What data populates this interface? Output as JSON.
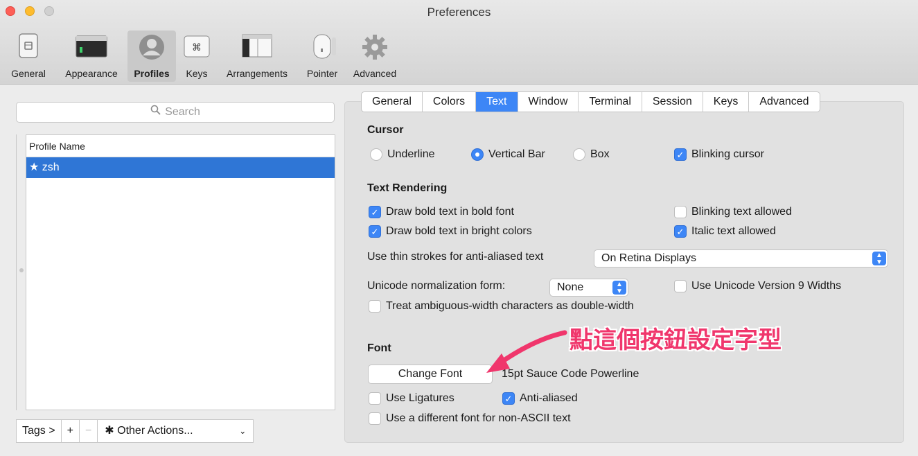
{
  "window": {
    "title": "Preferences"
  },
  "toolbar": {
    "items": [
      {
        "label": "General",
        "icon": "general-icon"
      },
      {
        "label": "Appearance",
        "icon": "appearance-icon"
      },
      {
        "label": "Profiles",
        "icon": "profiles-icon",
        "selected": true
      },
      {
        "label": "Keys",
        "icon": "command-key-icon"
      },
      {
        "label": "Arrangements",
        "icon": "arrangements-icon"
      },
      {
        "label": "Pointer",
        "icon": "mouse-icon"
      },
      {
        "label": "Advanced",
        "icon": "gear-icon"
      }
    ]
  },
  "sidebar": {
    "search_placeholder": "Search",
    "list_header": "Profile Name",
    "profiles": [
      {
        "label": "★ zsh",
        "selected": true
      }
    ],
    "bottom": {
      "tags": "Tags >",
      "add": "+",
      "remove": "−",
      "actions": "Other Actions...",
      "actions_chevron": "⌄"
    }
  },
  "tabs": [
    "General",
    "Colors",
    "Text",
    "Window",
    "Terminal",
    "Session",
    "Keys",
    "Advanced"
  ],
  "active_tab": "Text",
  "cursor": {
    "heading": "Cursor",
    "underline": "Underline",
    "vertical_bar": "Vertical Bar",
    "box": "Box",
    "blinking": "Blinking cursor",
    "selected": "Vertical Bar",
    "blinking_checked": true
  },
  "text_rendering": {
    "heading": "Text Rendering",
    "bold_font": {
      "label": "Draw bold text in bold font",
      "checked": true
    },
    "bright_colors": {
      "label": "Draw bold text in bright colors",
      "checked": true
    },
    "blinking_text": {
      "label": "Blinking text allowed",
      "checked": false
    },
    "italic_text": {
      "label": "Italic text allowed",
      "checked": true
    },
    "thin_strokes_label": "Use thin strokes for anti-aliased text",
    "thin_strokes_value": "On Retina Displays",
    "unicode_norm_label": "Unicode normalization form:",
    "unicode_norm_value": "None",
    "unicode9": {
      "label": "Use Unicode Version 9 Widths",
      "checked": false
    },
    "ambiguous": {
      "label": "Treat ambiguous-width characters as double-width",
      "checked": false
    }
  },
  "font": {
    "heading": "Font",
    "change_button": "Change Font",
    "current": "15pt Sauce Code Powerline",
    "ligatures": {
      "label": "Use Ligatures",
      "checked": false
    },
    "anti_aliased": {
      "label": "Anti-aliased",
      "checked": true
    },
    "non_ascii": {
      "label": "Use a different font for non-ASCII text",
      "checked": false
    }
  },
  "annotation": {
    "text": "點這個按鈕設定字型",
    "color": "#f0366c"
  },
  "colors": {
    "accent": "#3d86f6",
    "selection": "#2f76d6",
    "annotation": "#f0366c"
  }
}
